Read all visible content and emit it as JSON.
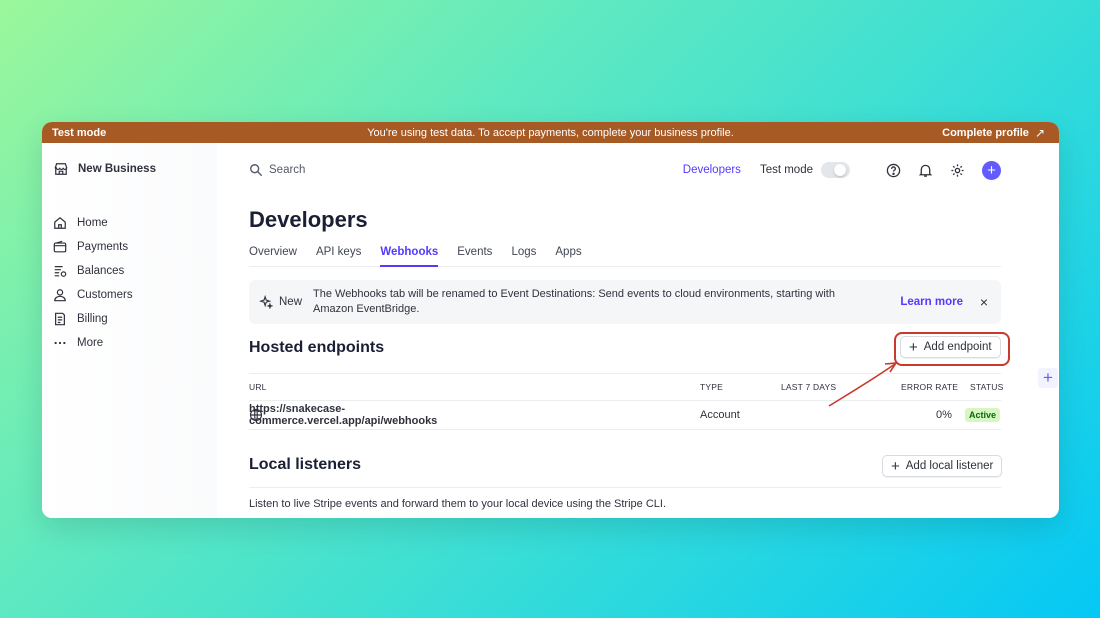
{
  "banner_bar": {
    "left": "Test mode",
    "message": "You're using test data. To accept payments, complete your business profile.",
    "cta": "Complete profile",
    "cta_icon": "arrow-up-right-icon"
  },
  "sidebar": {
    "brand": "New Business",
    "items": [
      {
        "label": "Home",
        "icon": "home-icon"
      },
      {
        "label": "Payments",
        "icon": "wallet-icon"
      },
      {
        "label": "Balances",
        "icon": "balances-icon"
      },
      {
        "label": "Customers",
        "icon": "person-icon"
      },
      {
        "label": "Billing",
        "icon": "billing-icon"
      },
      {
        "label": "More",
        "icon": "ellipsis-icon"
      }
    ]
  },
  "topbar": {
    "search_label": "Search",
    "developers_link": "Developers",
    "test_mode_label": "Test mode"
  },
  "page": {
    "title": "Developers",
    "tabs": [
      "Overview",
      "API keys",
      "Webhooks",
      "Events",
      "Logs",
      "Apps"
    ],
    "active_tab": "Webhooks"
  },
  "notice": {
    "tag": "New",
    "text": "The Webhooks tab will be renamed to Event Destinations: Send events to cloud environments, starting with Amazon EventBridge.",
    "learn_more": "Learn more",
    "close": "×"
  },
  "hosted": {
    "title": "Hosted endpoints",
    "add_button": "Add endpoint",
    "columns": [
      "URL",
      "TYPE",
      "LAST 7 DAYS",
      "ERROR RATE",
      "STATUS"
    ],
    "rows": [
      {
        "url": "https://snakecase-commerce.vercel.app/api/webhooks",
        "type": "Account",
        "last7": "",
        "error_rate": "0%",
        "status": "Active"
      }
    ]
  },
  "local": {
    "title": "Local listeners",
    "add_button": "Add local listener",
    "description": "Listen to live Stripe events and forward them to your local device using the Stripe CLI."
  },
  "colors": {
    "accent": "#533afd",
    "test_bar": "#a85a24",
    "annotation": "#c83a2e"
  }
}
